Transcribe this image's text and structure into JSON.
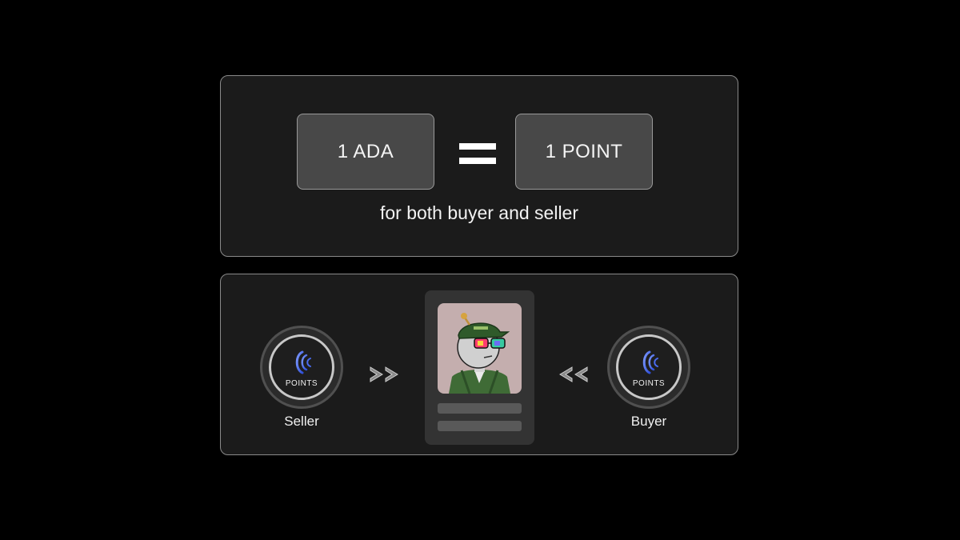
{
  "conversion": {
    "left_value": "1 ADA",
    "right_value": "1 POINT",
    "operator_icon": "equals-icon",
    "caption": "for both buyer and seller"
  },
  "flow": {
    "seller": {
      "wallet_label": "POINTS",
      "name": "Seller",
      "icon": "points-logo-icon"
    },
    "buyer": {
      "wallet_label": "POINTS",
      "name": "Buyer",
      "icon": "points-logo-icon"
    },
    "left_arrow_icon": "double-chevron-right-icon",
    "right_arrow_icon": "double-chevron-left-icon",
    "nft_card": {
      "image": "nft-avatar-image"
    }
  },
  "colors": {
    "background": "#000000",
    "panel": "#1b1b1b",
    "panel_border": "#8a8a8a",
    "value_box": "#484848",
    "logo_blue": "#4a6cf0",
    "nft_background": "#c4aeae"
  }
}
